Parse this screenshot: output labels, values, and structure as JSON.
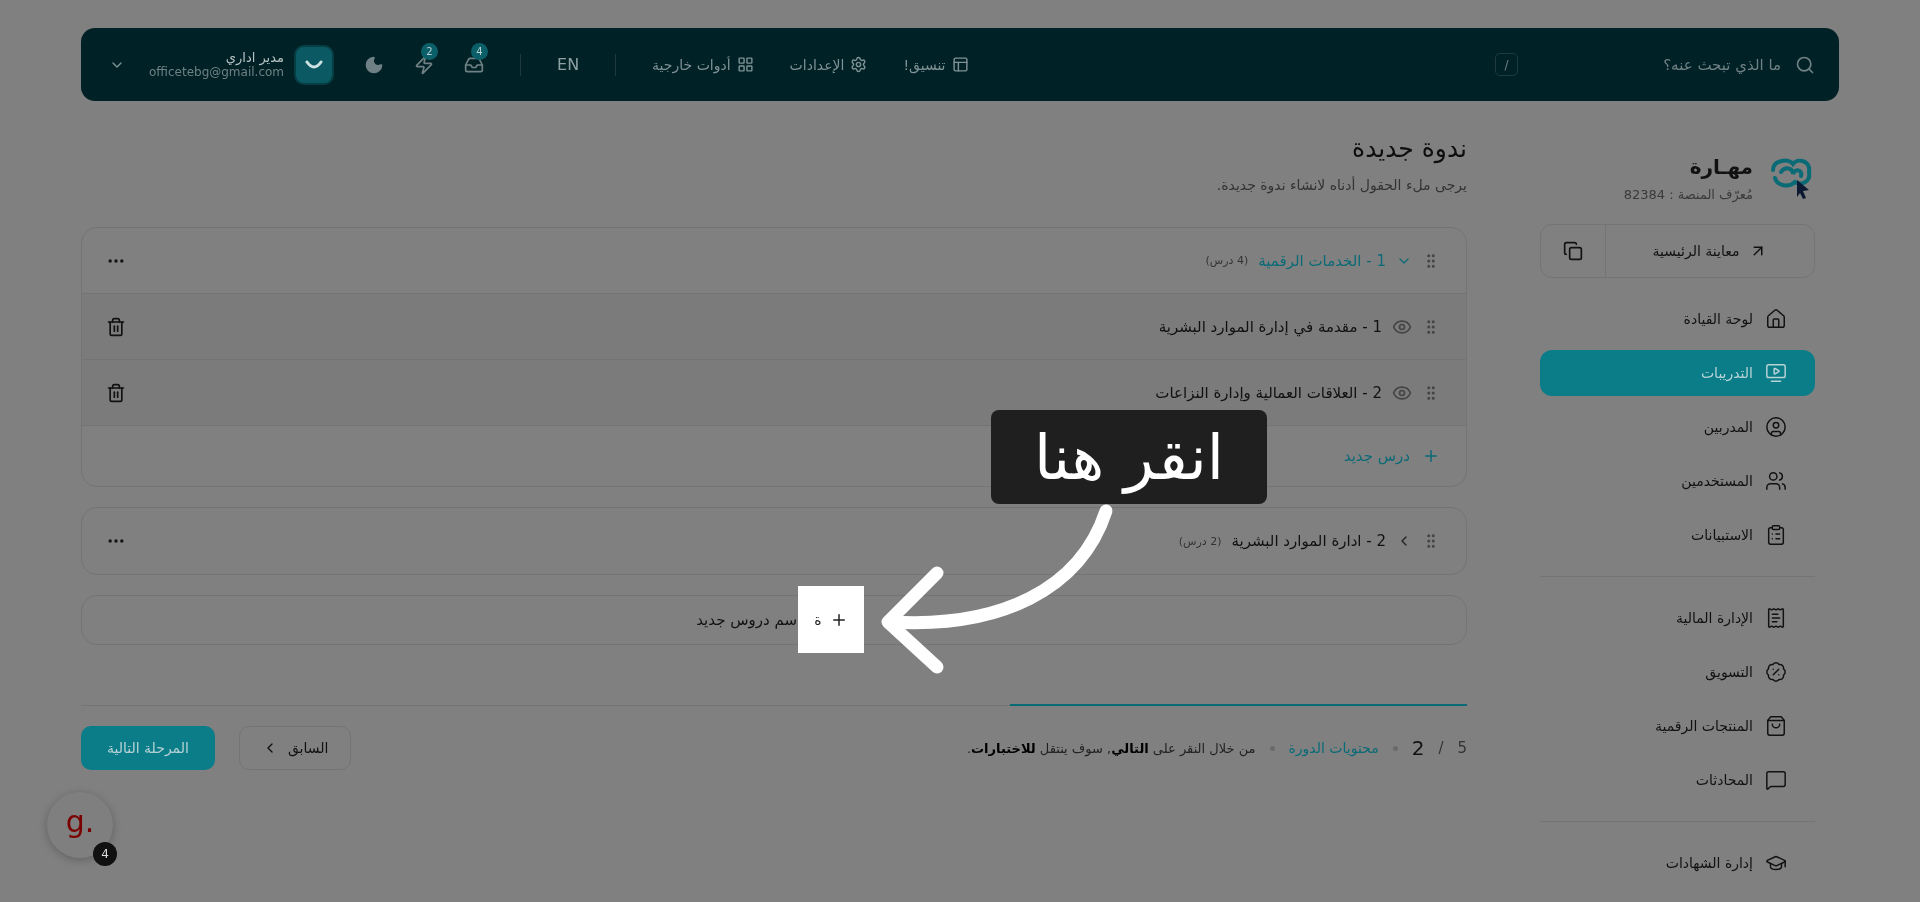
{
  "topbar": {
    "search": {
      "placeholder": "ما الذي تبحث عنه؟",
      "shortcut": "/"
    },
    "nav": [
      {
        "label": "تنسيق!"
      },
      {
        "label": "الإعدادات"
      },
      {
        "label": "أدوات خارجية"
      }
    ],
    "language": "EN",
    "notifications": [
      {
        "count": "4"
      },
      {
        "count": "2"
      }
    ],
    "user": {
      "name": "مدير اداري",
      "email": "officetebg@gmail.com"
    }
  },
  "sidebar": {
    "brand": "مهـارة",
    "platform_id": "مُعرّف المنصة : 82384",
    "preview": "معاينة الرئيسية",
    "sections": [
      {
        "items": [
          {
            "label": "لوحة القيادة",
            "selected": false
          },
          {
            "label": "التدريبات",
            "selected": true
          },
          {
            "label": "المدربين",
            "selected": false
          },
          {
            "label": "المستخدمين",
            "selected": false
          },
          {
            "label": "الاستبيانات",
            "selected": false
          }
        ]
      },
      {
        "items": [
          {
            "label": "الإدارة المالية",
            "selected": false
          },
          {
            "label": "التسويق",
            "selected": false
          },
          {
            "label": "المنتجات الرقمية",
            "selected": false
          },
          {
            "label": "المحادثات",
            "selected": false
          }
        ]
      },
      {
        "items": [
          {
            "label": "إدارة الشهادات",
            "selected": false
          }
        ]
      }
    ]
  },
  "page": {
    "title": "ندوة جديدة",
    "subtitle": "يرجى ملء الحقول أدناه لانشاء ندوة جديدة."
  },
  "sections": [
    {
      "title": "1 - الخدمات الرقمية",
      "count": "(4 درس)",
      "expanded": true,
      "lessons": [
        {
          "title": "1 - مقدمة في إدارة الموارد البشرية"
        },
        {
          "title": "2 - العلاقات العمالية وإدارة النزاعات"
        }
      ],
      "add_lesson": "درس جديد"
    },
    {
      "title": "2 - ادارة الموارد البشرية",
      "count": "(2 درس)",
      "expanded": false
    }
  ],
  "add_section": {
    "label": "سم دروس جديد",
    "highlight_text": "ة"
  },
  "progress": {
    "level": 0.33
  },
  "footer": {
    "step_current": "2",
    "step_separator": "/",
    "step_total": "5",
    "step_name": "محتويات الدورة",
    "hint": "من خلال النقر على **التالي**, سوف ينتقل **للاختبارات**.",
    "previous": "السابق",
    "next": "المرحلة التالية"
  },
  "tutorial": {
    "callout": "انقر هنا"
  },
  "chat_widget": {
    "logo": "g.",
    "badge": "4"
  }
}
